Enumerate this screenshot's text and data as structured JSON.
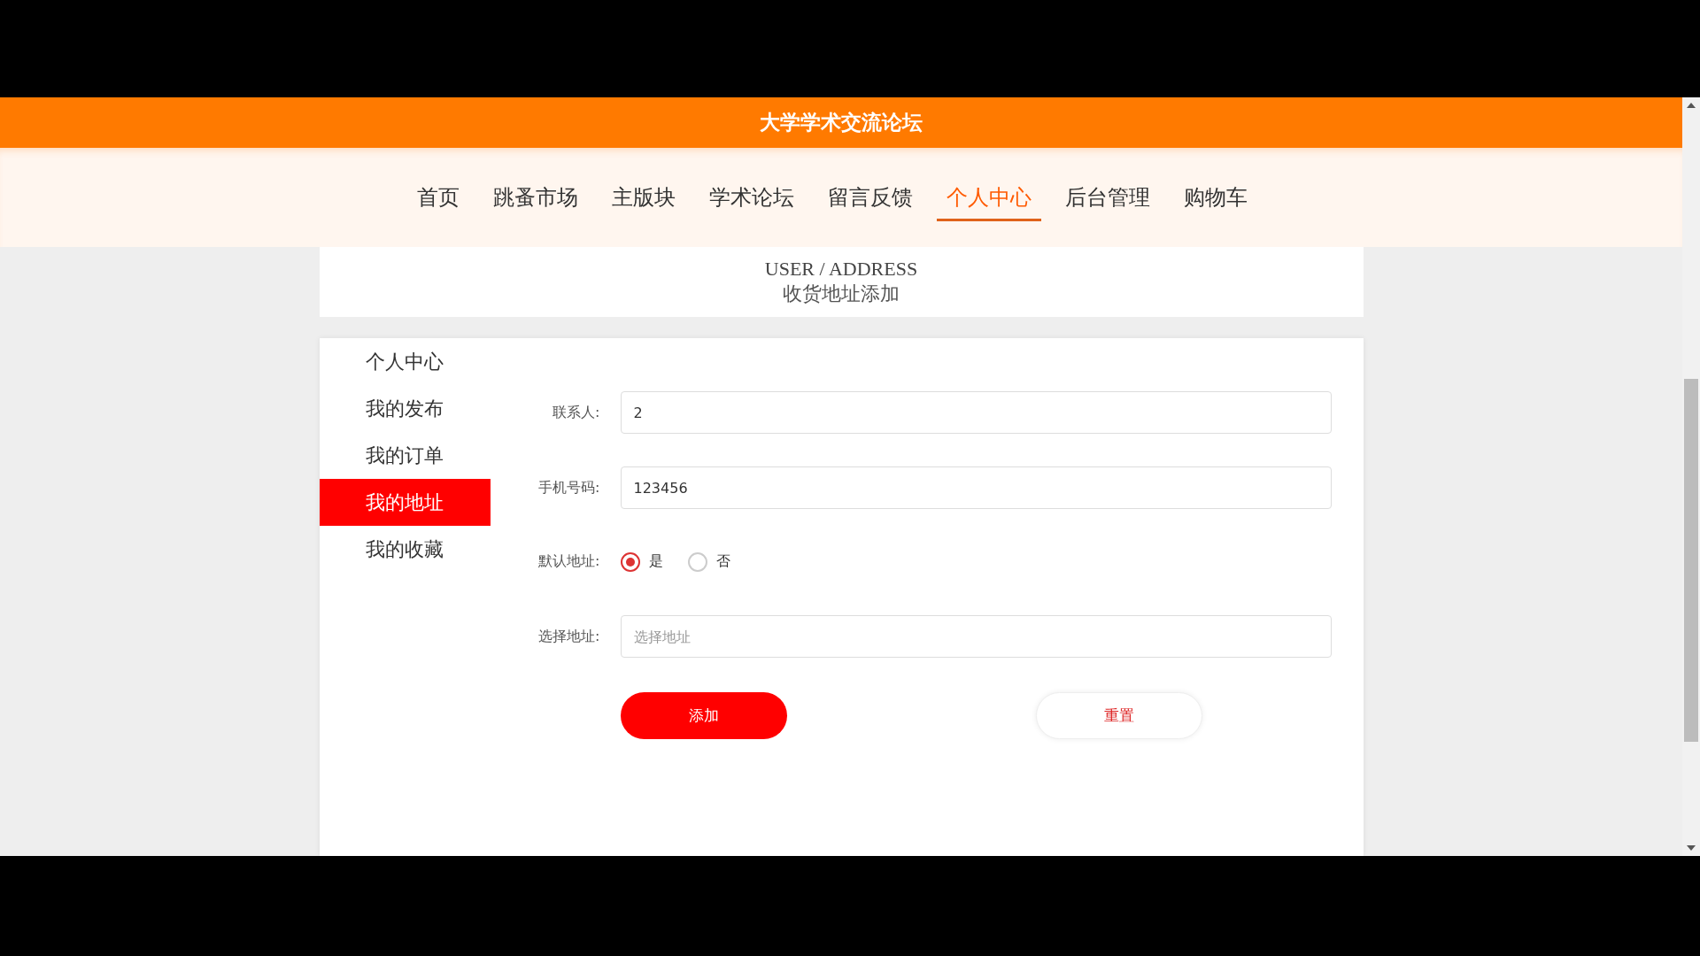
{
  "site_title": "大学学术交流论坛",
  "nav": [
    {
      "label": "首页",
      "selected": false
    },
    {
      "label": "跳蚤市场",
      "selected": false
    },
    {
      "label": "主版块",
      "selected": false
    },
    {
      "label": "学术论坛",
      "selected": false
    },
    {
      "label": "留言反馈",
      "selected": false
    },
    {
      "label": "个人中心",
      "selected": true
    },
    {
      "label": "后台管理",
      "selected": false
    },
    {
      "label": "购物车",
      "selected": false
    }
  ],
  "page_header": {
    "subtitle": "USER / ADDRESS",
    "title": "收货地址添加"
  },
  "sidebar": {
    "items": [
      {
        "label": "个人中心",
        "selected": false
      },
      {
        "label": "我的发布",
        "selected": false
      },
      {
        "label": "我的订单",
        "selected": false
      },
      {
        "label": "我的地址",
        "selected": true
      },
      {
        "label": "我的收藏",
        "selected": false
      }
    ]
  },
  "form": {
    "fields": [
      {
        "kind": "text",
        "label": "联系人:",
        "value": "2"
      },
      {
        "kind": "text",
        "label": "手机号码:",
        "value": "123456"
      },
      {
        "kind": "radio",
        "label": "默认地址:",
        "options": [
          {
            "label": "是",
            "selected": true
          },
          {
            "label": "否",
            "selected": false
          }
        ]
      },
      {
        "kind": "text",
        "label": "选择地址:",
        "placeholder": "选择地址"
      }
    ],
    "buttons": [
      {
        "kind": "primary",
        "label": "添加"
      },
      {
        "kind": "secondary",
        "label": "重置"
      }
    ]
  }
}
